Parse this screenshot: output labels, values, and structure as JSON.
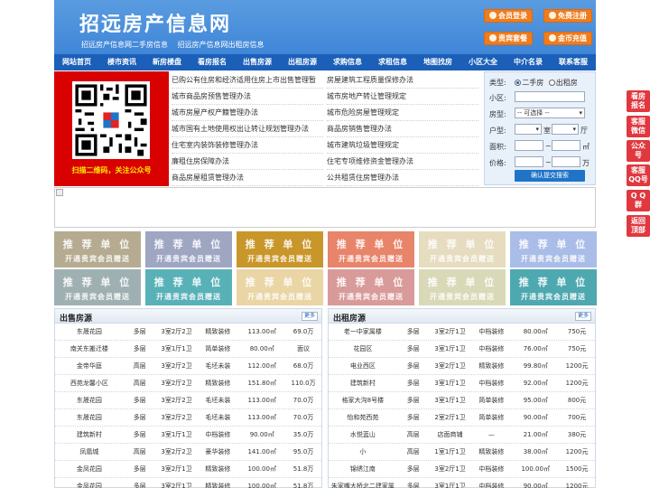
{
  "header": {
    "title": "招远房产信息网",
    "subtitles": [
      "招远房产信息网二手房信息",
      "招远房产信息网出租房信息"
    ],
    "buttons": [
      "会员登录",
      "免费注册",
      "贵宾套餐",
      "金币充值"
    ]
  },
  "nav": [
    "网站首页",
    "楼市资讯",
    "新房楼盘",
    "看房报名",
    "出售房源",
    "出租房源",
    "求购信息",
    "求租信息",
    "地图找房",
    "小区大全",
    "中介名录",
    "联系客服"
  ],
  "qr": {
    "caption": "扫描二维码，关注公众号"
  },
  "links_left": [
    "已购公有住房和经济适用住房上市出售管理暂",
    "城市商品房预售管理办法",
    "城市房屋产权产籍管理办法",
    "城市国有土地使用权出让转让规划管理办法",
    "住宅室内装饰装修管理办法",
    "廉租住房保障办法",
    "商品房屋租赁管理办法"
  ],
  "links_right": [
    "房屋建筑工程质量保修办法",
    "城市房地产转让管理规定",
    "城市危险房屋管理规定",
    "商品房销售管理办法",
    "城市建筑垃圾管理规定",
    "住宅专项维修资金管理办法",
    "公共租赁住房管理办法"
  ],
  "search": {
    "type_label": "类型:",
    "opt_sale": "二手房",
    "opt_rent": "出租房",
    "community_label": "小区:",
    "housetype_label": "房型:",
    "housetype_value": "-- 可选择 --",
    "layout_label": "户型:",
    "layout_room": "室",
    "layout_hall": "厅",
    "area_label": "面积:",
    "area_unit": "㎡",
    "price_label": "价格:",
    "price_unit": "万",
    "range_sep": "~",
    "submit": "确认提交搜索"
  },
  "ads": {
    "title": "推 荐 单 位",
    "sub": "开通贵宾会员赠送",
    "colors": [
      "#b5ab90",
      "#9ea6c2",
      "#c9962a",
      "#e8846a",
      "#e6dcc0",
      "#a9bde8",
      "#9fb0b3",
      "#59b1b8",
      "#ead5a4",
      "#d99a9a",
      "#d9d9b8",
      "#4ea8b0"
    ]
  },
  "sale": {
    "title": "出售房源",
    "more": "更多",
    "rows": [
      [
        "东晟花园",
        "多层",
        "3室2厅2卫",
        "精致装修",
        "113.00㎡",
        "69.0万"
      ],
      [
        "南关东搬迁楼",
        "多层",
        "3室1厅1卫",
        "简单装修",
        "80.00㎡",
        "面议"
      ],
      [
        "金帝华庭",
        "高层",
        "3室2厅2卫",
        "毛坯未装",
        "112.00㎡",
        "68.0万"
      ],
      [
        "西苑龙馨小区",
        "高层",
        "3室2厅2卫",
        "精致装修",
        "151.80㎡",
        "110.0万"
      ],
      [
        "东晟花园",
        "多层",
        "3室2厅2卫",
        "毛坯未装",
        "113.00㎡",
        "70.0万"
      ],
      [
        "东晟花园",
        "多层",
        "3室2厅2卫",
        "毛坯未装",
        "113.00㎡",
        "70.0万"
      ],
      [
        "建筑新村",
        "多层",
        "3室1厅1卫",
        "中档装修",
        "90.00㎡",
        "35.0万"
      ],
      [
        "凤凰城",
        "高层",
        "3室2厅2卫",
        "豪华装修",
        "141.00㎡",
        "95.0万"
      ],
      [
        "金凤花园",
        "多层",
        "3室2厅1卫",
        "精致装修",
        "100.00㎡",
        "51.8万"
      ],
      [
        "金凤花园",
        "多层",
        "3室2厅1卫",
        "精致装修",
        "100.00㎡",
        "51.8万"
      ]
    ]
  },
  "rent": {
    "title": "出租房源",
    "more": "更多",
    "rows": [
      [
        "老一中家属楼",
        "多层",
        "3室2厅1卫",
        "中档装修",
        "80.00㎡",
        "750元"
      ],
      [
        "花园区",
        "多层",
        "3室1厅1卫",
        "中档装修",
        "76.00㎡",
        "750元"
      ],
      [
        "电业西区",
        "多层",
        "3室2厅1卫",
        "精致装修",
        "99.80㎡",
        "1200元"
      ],
      [
        "建筑新村",
        "多层",
        "3室1厅1卫",
        "中档装修",
        "92.00㎡",
        "1200元"
      ],
      [
        "格家大沟8号楼",
        "多层",
        "3室1厅1卫",
        "简单装修",
        "95.00㎡",
        "800元"
      ],
      [
        "怡和苑西苑",
        "多层",
        "2室2厅1卫",
        "简单装修",
        "90.00㎡",
        "700元"
      ],
      [
        "水悦蓝山",
        "高层",
        "店面商铺",
        "—",
        "21.00㎡",
        "380元"
      ],
      [
        "小",
        "高层",
        "1室1厅1卫",
        "精致装修",
        "38.00㎡",
        "1200元"
      ],
      [
        "锦绣江南",
        "多层",
        "3室2厅1卫",
        "中档装修",
        "100.00㎡",
        "1500元"
      ],
      [
        "朱家嘴大桥北二建家属",
        "多层",
        "3室1厅1卫",
        "中档装修",
        "90.00㎡",
        "1200元"
      ]
    ]
  },
  "side": [
    [
      "看房",
      "报名"
    ],
    [
      "客服",
      "微信"
    ],
    [
      "公众",
      "号"
    ],
    [
      "客服",
      "QQ号"
    ],
    [
      "Q Q",
      "群"
    ],
    [
      "返回",
      "顶部"
    ]
  ]
}
